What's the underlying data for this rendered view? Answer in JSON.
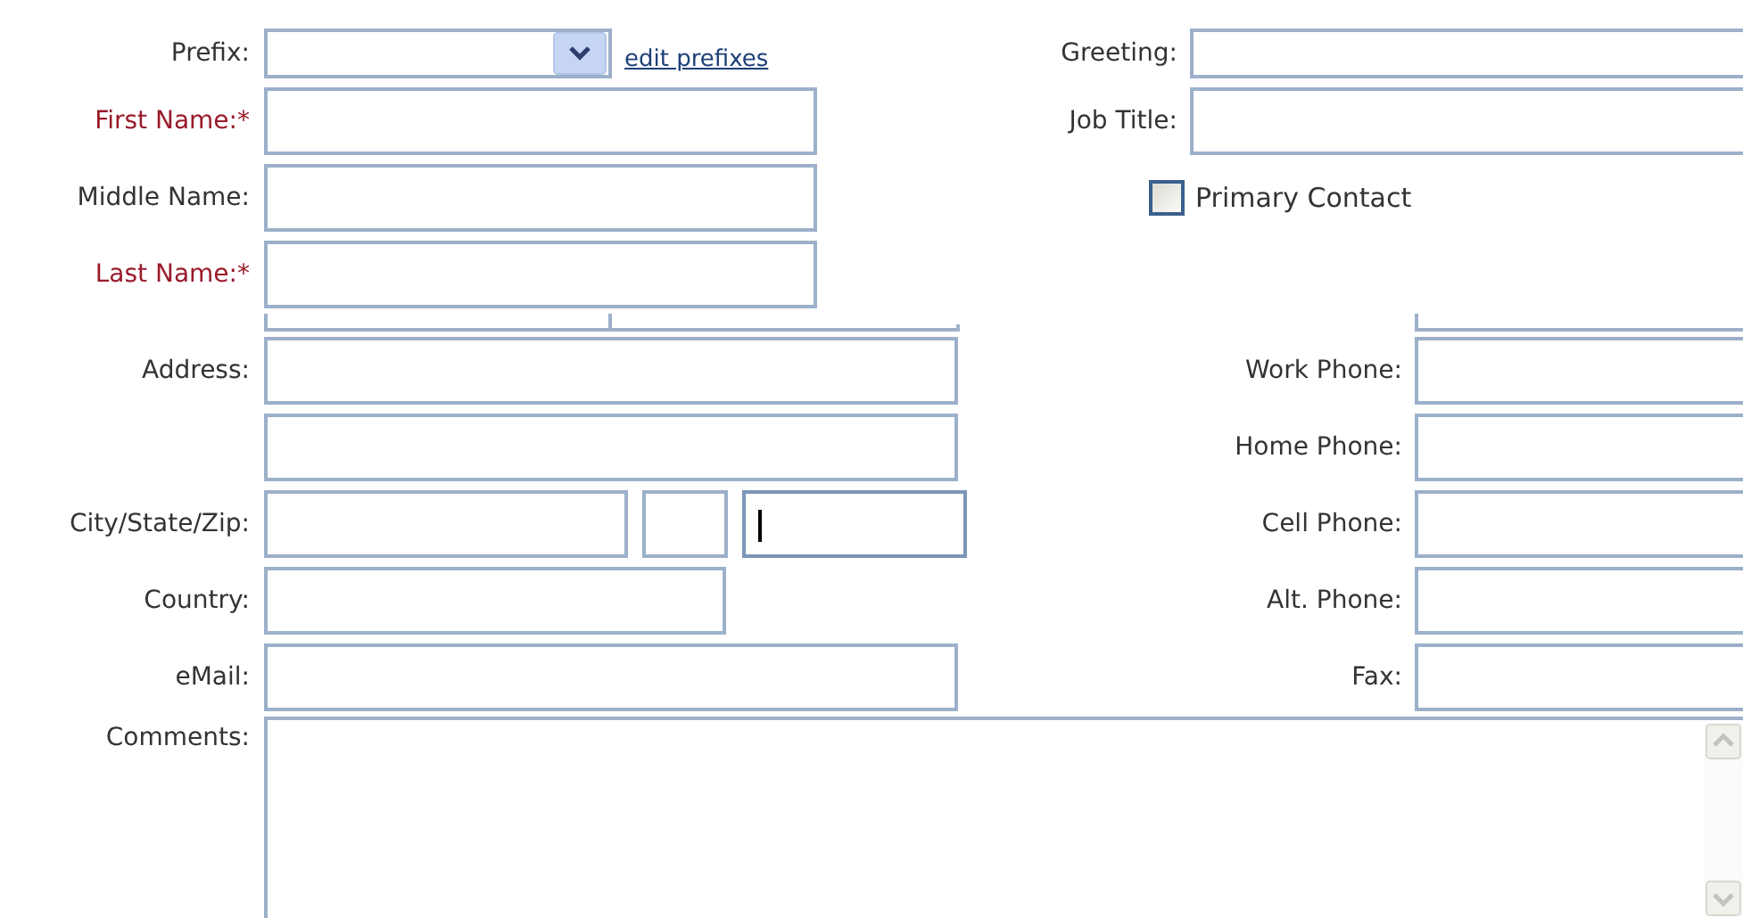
{
  "top_left": [
    {
      "label": "Prefix:",
      "kind": "select",
      "required": false,
      "link": "edit prefixes"
    },
    {
      "label": "First Name:*",
      "kind": "text",
      "required": true
    },
    {
      "label": "Middle Name:",
      "kind": "text",
      "required": false
    },
    {
      "label": "Last Name:*",
      "kind": "text",
      "required": true
    }
  ],
  "top_right": [
    {
      "label": "Greeting:"
    },
    {
      "label": "Job Title:"
    }
  ],
  "primary_contact": {
    "label": "Primary Contact",
    "checked": false
  },
  "address_rows": [
    {
      "label": "Address:",
      "fields": [
        {
          "kind": "long",
          "focused": false
        }
      ]
    },
    {
      "fields": [
        {
          "kind": "long",
          "focused": false
        }
      ]
    },
    {
      "label": "City/State/Zip:",
      "fields": [
        {
          "kind": "city",
          "focused": false
        },
        {
          "kind": "state",
          "focused": false
        },
        {
          "kind": "zip",
          "focused": true
        }
      ]
    },
    {
      "label": "Country:",
      "fields": [
        {
          "kind": "medium",
          "focused": false
        }
      ]
    },
    {
      "label": "eMail:",
      "fields": [
        {
          "kind": "long",
          "focused": false
        }
      ]
    }
  ],
  "phone_rows": [
    {
      "label": "Work Phone:"
    },
    {
      "label": "Home Phone:"
    },
    {
      "label": "Cell Phone:"
    },
    {
      "label": "Alt. Phone:"
    },
    {
      "label": "Fax:"
    }
  ],
  "comments": {
    "label": "Comments:"
  }
}
